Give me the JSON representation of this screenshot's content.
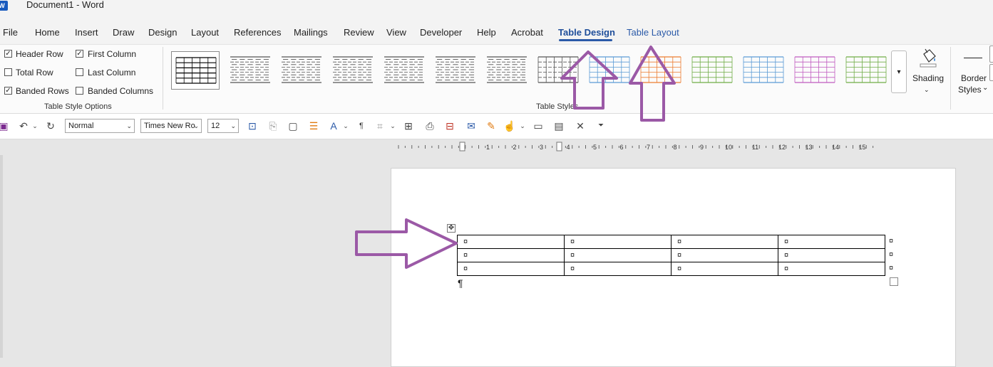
{
  "window": {
    "app_icon_letter": "W",
    "title": "Document1 - Word"
  },
  "tabs": [
    {
      "label": "File"
    },
    {
      "label": "Home"
    },
    {
      "label": "Insert"
    },
    {
      "label": "Draw"
    },
    {
      "label": "Design"
    },
    {
      "label": "Layout"
    },
    {
      "label": "References"
    },
    {
      "label": "Mailings"
    },
    {
      "label": "Review"
    },
    {
      "label": "View"
    },
    {
      "label": "Developer"
    },
    {
      "label": "Help"
    },
    {
      "label": "Acrobat"
    },
    {
      "label": "Table Design"
    },
    {
      "label": "Table Layout"
    }
  ],
  "active_tab": "Table Design",
  "table_style_options": {
    "group_label": "Table Style Options",
    "header_row": {
      "label": "Header Row",
      "checked": true
    },
    "total_row": {
      "label": "Total Row",
      "checked": false
    },
    "banded_rows": {
      "label": "Banded Rows",
      "checked": true
    },
    "first_column": {
      "label": "First Column",
      "checked": true
    },
    "last_column": {
      "label": "Last Column",
      "checked": false
    },
    "banded_columns": {
      "label": "Banded Columns",
      "checked": false
    }
  },
  "table_styles": {
    "group_label": "Table Styles",
    "thumb_colors": [
      "#000000",
      "#555555",
      "#555555",
      "#555555",
      "#555555",
      "#555555",
      "#555555",
      "#555555",
      "#5b9bd5",
      "#ed7d31",
      "#70ad47",
      "#5b9bd5",
      "#c05bc0",
      "#70ad47"
    ]
  },
  "shading": {
    "label": "Shading",
    "icon": "paint-bucket-icon"
  },
  "border_styles": {
    "label_line1": "Border",
    "label_line2": "Styles"
  },
  "toolbar": {
    "style_value": "Normal",
    "font_value": "Times New Ro",
    "size_value": "12"
  },
  "ruler_labels": [
    "1",
    "2",
    "3",
    "4",
    "5",
    "6",
    "7",
    "8",
    "9",
    "10",
    "11",
    "12",
    "13",
    "14",
    "15"
  ],
  "document": {
    "rows": [
      [
        "¤",
        "¤",
        "¤",
        "¤"
      ],
      [
        "¤",
        "¤",
        "¤",
        "¤"
      ],
      [
        "¤",
        "¤",
        "¤",
        "¤"
      ]
    ],
    "row_end_marks": [
      "¤",
      "¤",
      "¤"
    ],
    "paragraph_mark": "¶",
    "move_handle_glyph": "✥"
  },
  "colors": {
    "annotation_arrow": "#9b59a6",
    "accent": "#2b5aa8"
  }
}
